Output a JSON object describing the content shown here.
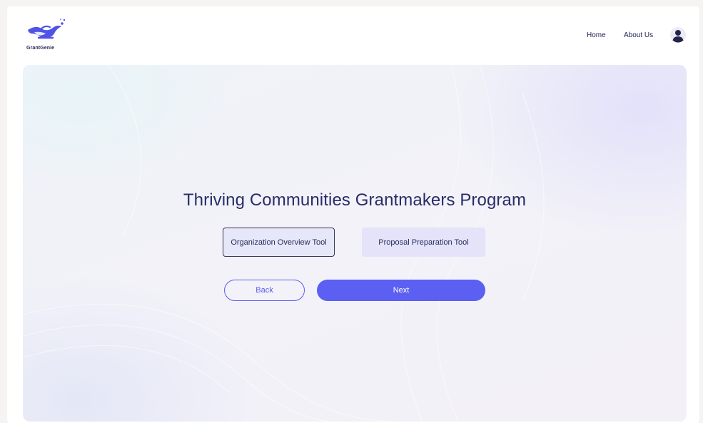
{
  "app": {
    "logo_text": "GrantGenie"
  },
  "nav": {
    "home": "Home",
    "about": "About Us",
    "account_icon": "user-icon"
  },
  "hero": {
    "title": "Thriving Communities Grantmakers Program",
    "tools": [
      {
        "label": "Organization Overview Tool",
        "selected": true
      },
      {
        "label": "Proposal Preparation Tool",
        "selected": false
      }
    ],
    "back_label": "Back",
    "next_label": "Next"
  },
  "colors": {
    "accent": "#5b5ff2",
    "title": "#2a2c67",
    "selected_border": "#35375c",
    "tool_bg": "#e4e3f9"
  }
}
